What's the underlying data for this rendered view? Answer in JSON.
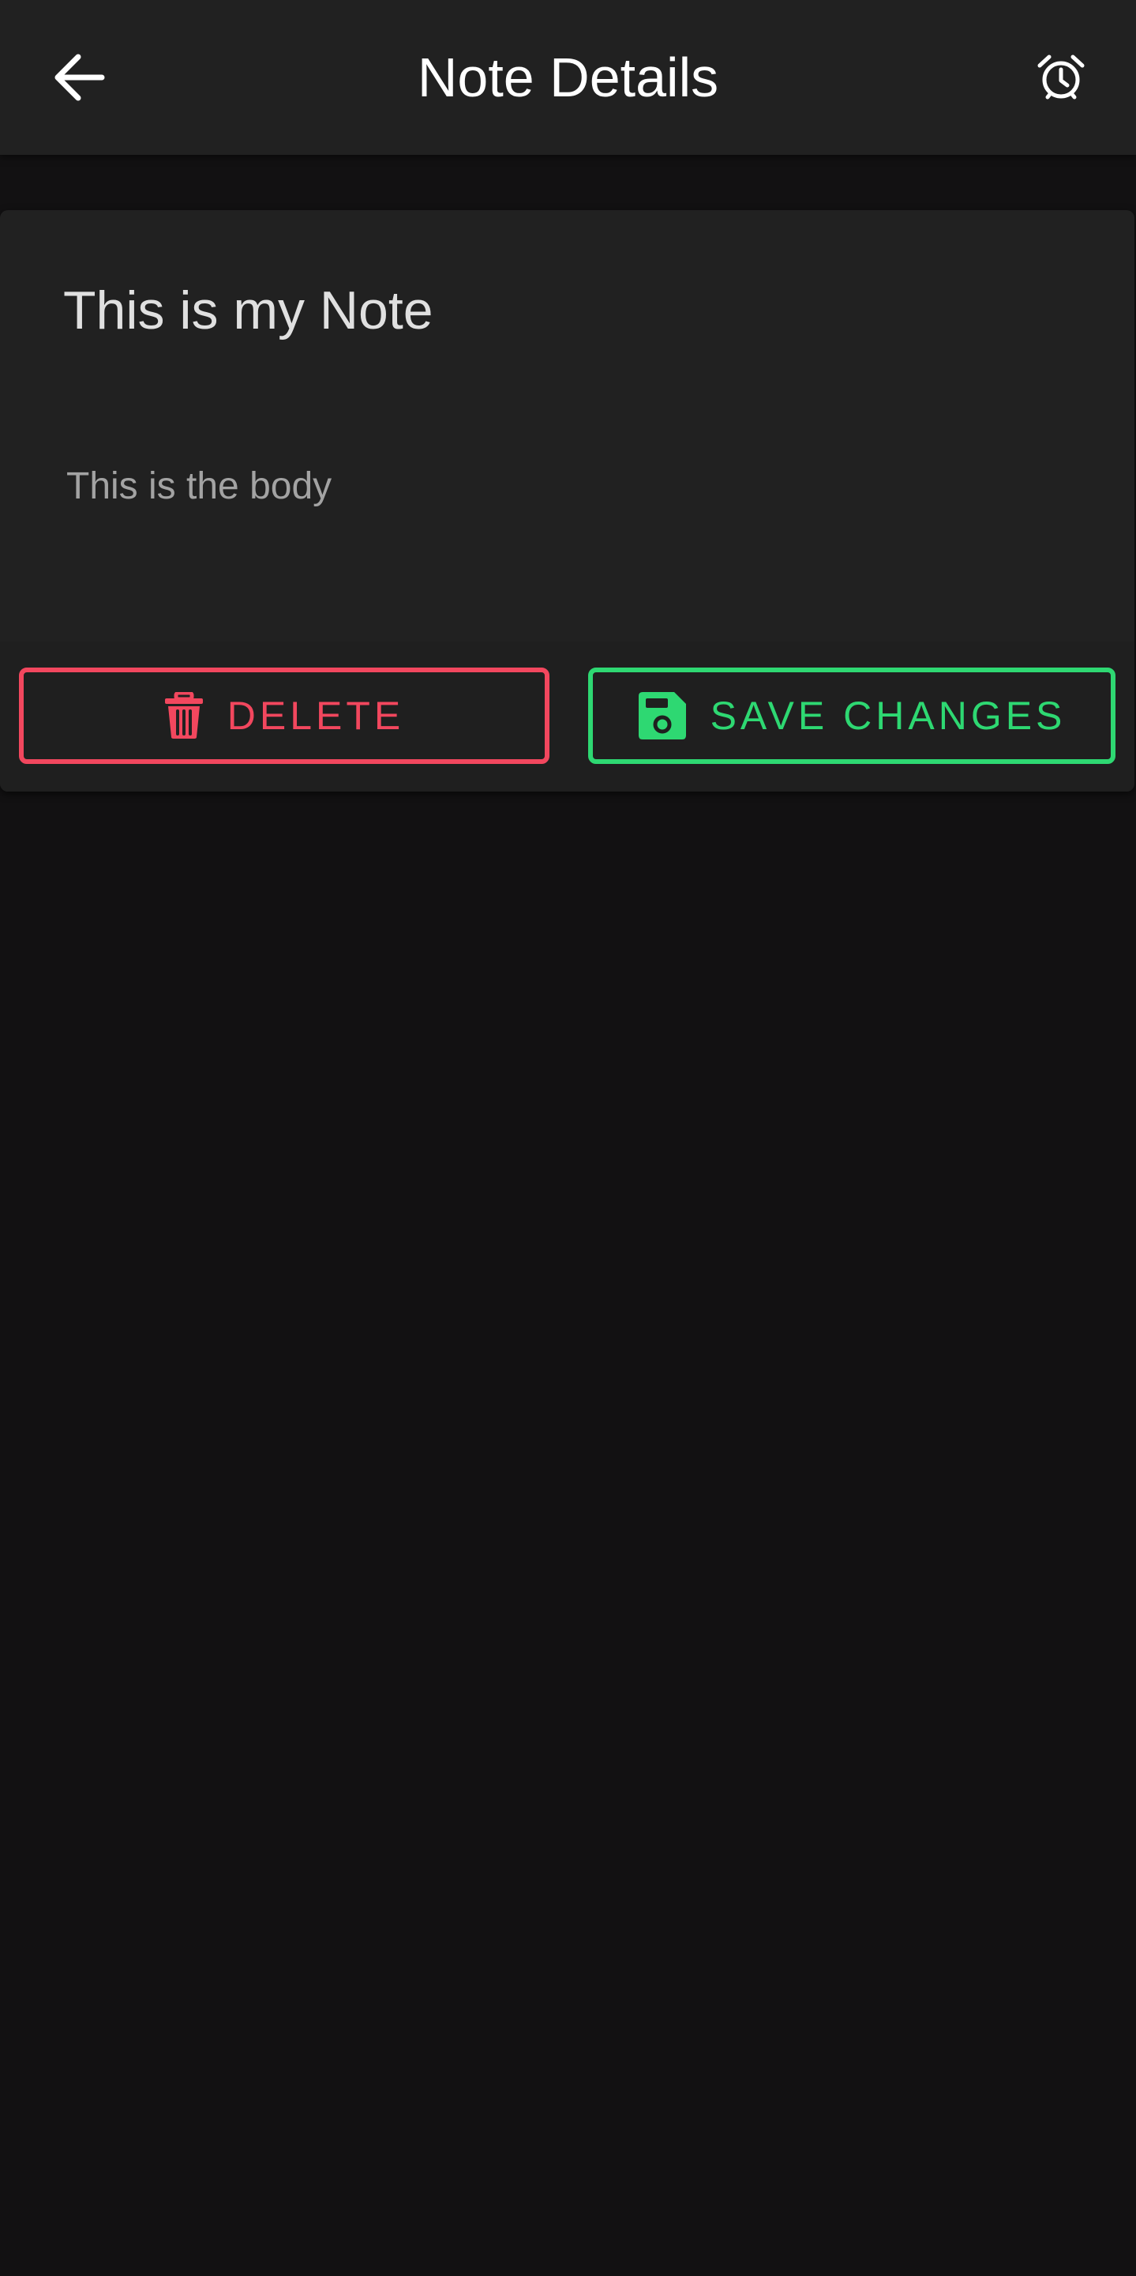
{
  "app_bar": {
    "title": "Note Details",
    "back_icon": "arrow-left-icon",
    "alarm_icon": "alarm-clock-icon"
  },
  "note": {
    "title_value": "This is my Note",
    "body_value": "This is the body"
  },
  "actions": {
    "delete_label": "DELETE",
    "delete_icon": "trash-icon",
    "delete_color": "#f2475e",
    "save_label": "SAVE CHANGES",
    "save_icon": "floppy-disk-icon",
    "save_color": "#2ed872"
  },
  "colors": {
    "background": "#121112",
    "surface": "#212121"
  }
}
